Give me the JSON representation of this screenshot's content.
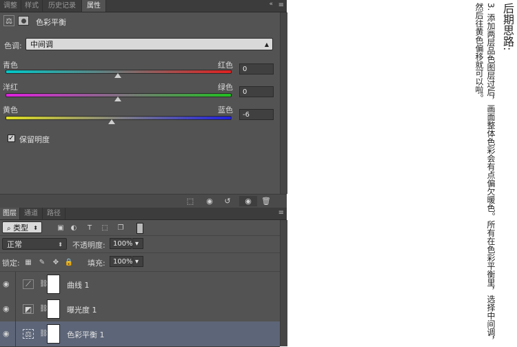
{
  "properties_panel": {
    "tabs": [
      "调整",
      "样式",
      "历史记录",
      "属性"
    ],
    "active_tab": "属性",
    "header_title": "色彩平衡",
    "tone_label": "色调:",
    "tone_value": "中间调",
    "sliders": [
      {
        "left_label": "青色",
        "right_label": "红色",
        "value": "0",
        "position": 0,
        "gradient": [
          "#00c8c8",
          "#e02020"
        ]
      },
      {
        "left_label": "洋红",
        "right_label": "绿色",
        "value": "0",
        "position": 0,
        "gradient": [
          "#e020e0",
          "#20c020"
        ]
      },
      {
        "left_label": "黄色",
        "right_label": "蓝色",
        "value": "-6",
        "position": -6,
        "gradient": [
          "#e0e020",
          "#2020e0"
        ]
      }
    ],
    "preserve_luminosity_label": "保留明度",
    "preserve_luminosity_checked": true
  },
  "layers_panel": {
    "tabs": [
      "图层",
      "通道",
      "路径"
    ],
    "active_tab": "图层",
    "filter_kind": "类型",
    "blend_mode": "正常",
    "opacity_label": "不透明度:",
    "opacity_value": "100%",
    "lock_label": "锁定:",
    "fill_label": "填充:",
    "fill_value": "100%",
    "layers": [
      {
        "name": "曲线 1",
        "icon": "curves-icon",
        "selected": false
      },
      {
        "name": "曝光度 1",
        "icon": "exposure-icon",
        "selected": false
      },
      {
        "name": "色彩平衡 1",
        "icon": "color-balance-icon",
        "selected": true
      }
    ]
  },
  "notes": {
    "title": "后期思路:",
    "line1": "3. 添加两层品色图层过后，画面整体色彩会有点偏欠暖色。所有在色彩平衡里，选择中间调，",
    "line2": "然后往黄色偏移就可以啦。"
  }
}
